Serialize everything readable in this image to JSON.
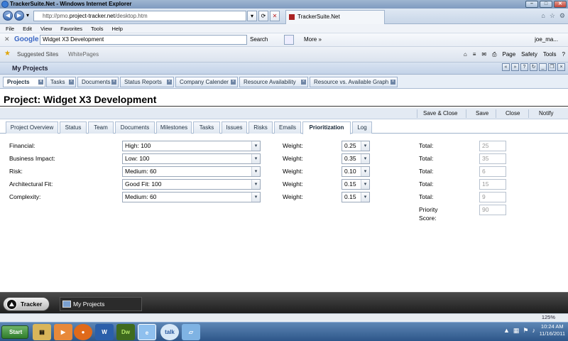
{
  "window": {
    "title": "TrackerSuite.Net - Windows Internet Explorer"
  },
  "browser": {
    "url_prefix": "http://pmo.",
    "url_host": "project-tracker.net",
    "url_path": "/desktop.htm",
    "tab_title": "TrackerSuite.Net",
    "menu": [
      "File",
      "Edit",
      "View",
      "Favorites",
      "Tools",
      "Help"
    ],
    "google": {
      "logo": "Google",
      "query": "Widget X3 Development",
      "search_label": "Search",
      "more_label": "More »",
      "user": "joe_ma..."
    },
    "favorites": {
      "suggested": "Suggested Sites",
      "webslice": "WhitePages"
    },
    "commands": [
      "Page",
      "Safety",
      "Tools"
    ]
  },
  "app": {
    "panel_title": "My Projects",
    "tabs": [
      "Projects",
      "Tasks",
      "Documents",
      "Status Reports",
      "Company Calender",
      "Resource Availability",
      "Resource vs. Available Graph"
    ],
    "project_title": "Project: Widget X3 Development",
    "actions": {
      "save_close": "Save & Close",
      "save": "Save",
      "close": "Close",
      "notify": "Notify"
    },
    "inner_tabs": [
      "Project Overview",
      "Status",
      "Team",
      "Documents",
      "Milestones",
      "Tasks",
      "Issues",
      "Risks",
      "Emails",
      "Prioritization",
      "Log"
    ],
    "weight_label": "Weight:",
    "total_label": "Total:",
    "factors": [
      {
        "label": "Financial:",
        "value": "High: 100",
        "weight": "0.25",
        "total": "25"
      },
      {
        "label": "Business Impact:",
        "value": "Low: 100",
        "weight": "0.35",
        "total": "35"
      },
      {
        "label": "Risk:",
        "value": "Medium: 60",
        "weight": "0.10",
        "total": "6"
      },
      {
        "label": "Architectural Fit:",
        "value": "Good Fit: 100",
        "weight": "0.15",
        "total": "15"
      },
      {
        "label": "Complexity:",
        "value": "Medium: 60",
        "weight": "0.15",
        "total": "9"
      }
    ],
    "priority": {
      "label_line1": "Priority",
      "label_line2": "Score:",
      "value": "90"
    }
  },
  "dock": {
    "tracker": "Tracker",
    "myprojects": "My Projects"
  },
  "statusbar": {
    "zoom": "125%"
  },
  "taskbar": {
    "start": "Start",
    "time": "10:24 AM",
    "date": "11/16/2011"
  }
}
